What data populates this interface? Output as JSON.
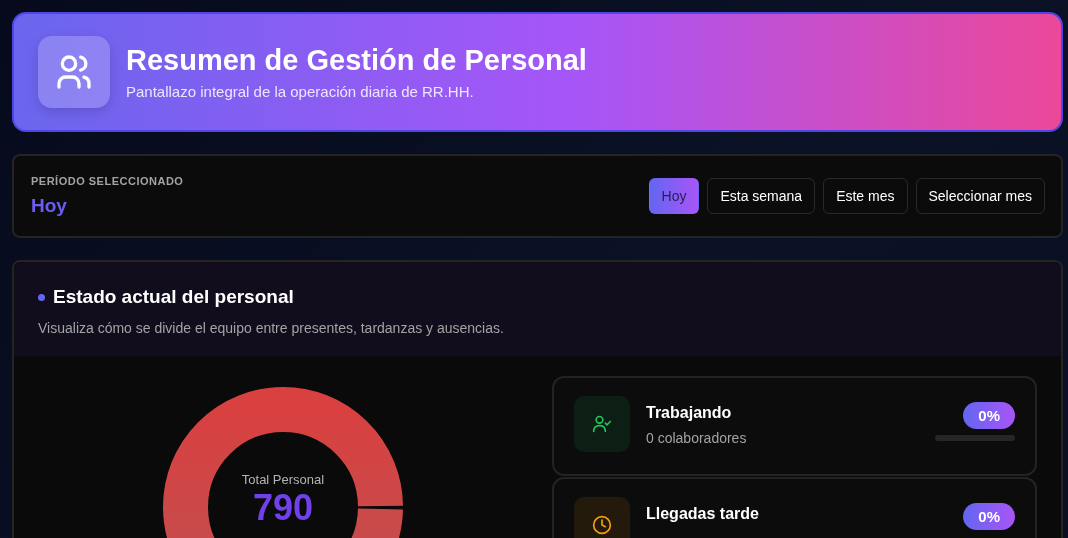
{
  "header": {
    "title": "Resumen de Gestión de Personal",
    "subtitle": "Pantallazo integral de la operación diaria de RR.HH."
  },
  "period": {
    "label": "PERÍODO SELECCIONADO",
    "value": "Hoy",
    "options": [
      {
        "label": "Hoy",
        "selected": true
      },
      {
        "label": "Esta semana",
        "selected": false
      },
      {
        "label": "Este mes",
        "selected": false
      },
      {
        "label": "Seleccionar mes",
        "selected": false
      }
    ]
  },
  "status": {
    "title": "Estado actual del personal",
    "description": "Visualiza cómo se divide el equipo entre presentes, tardanzas y ausencias.",
    "donut": {
      "center_label": "Total Personal",
      "center_value": "790"
    },
    "items": [
      {
        "kind": "working",
        "color": "#22c55e",
        "name": "Trabajando",
        "count": "0 colaboradores",
        "percent": "0%",
        "level": 0
      },
      {
        "kind": "late",
        "color": "#f59e0b",
        "name": "Llegadas tarde",
        "percent": "0%"
      }
    ]
  }
}
